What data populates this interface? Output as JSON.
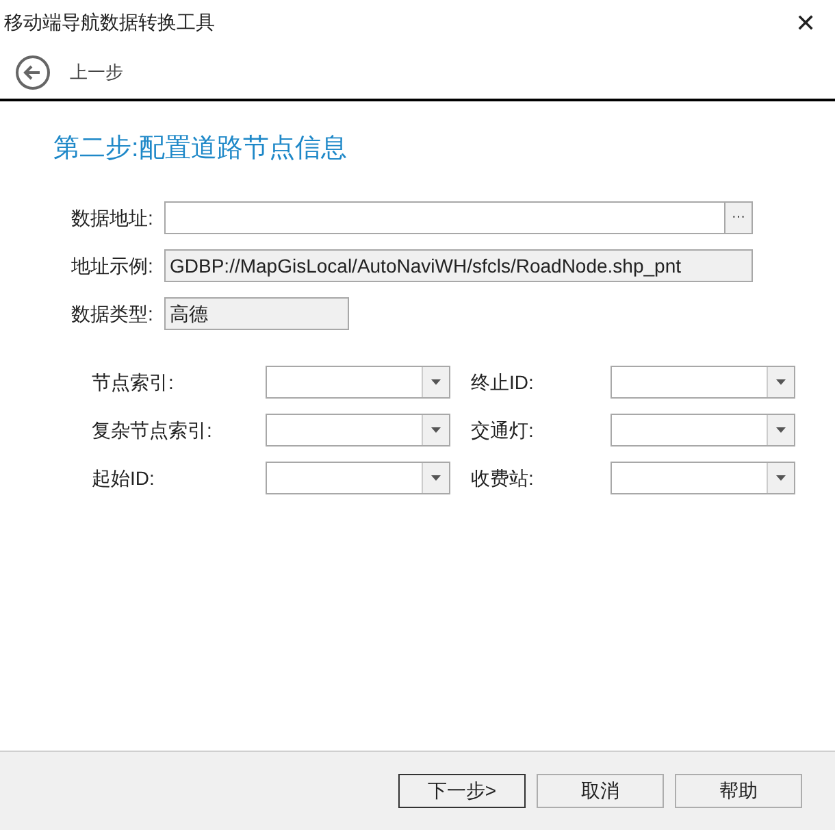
{
  "window": {
    "title": "移动端导航数据转换工具",
    "close": "✕"
  },
  "toolbar": {
    "back_label": "上一步"
  },
  "heading": "第二步:配置道路节点信息",
  "fields": [
    {
      "label": "数据地址:",
      "readonly": false,
      "browse": "···",
      "wide": true
    },
    {
      "label": "地址示例:",
      "value": "GDBP://MapGisLocal/AutoNaviWH/sfcls/RoadNode.shp_pnt",
      "readonly": true,
      "wide": true
    },
    {
      "label": "数据类型:",
      "value": "高德",
      "readonly": true,
      "wide": false
    }
  ],
  "combos": [
    {
      "label": "节点索引:"
    },
    {
      "label": "终止ID:"
    },
    {
      "label": "复杂节点索引:"
    },
    {
      "label": "交通灯:"
    },
    {
      "label": "起始ID:"
    },
    {
      "label": "收费站:"
    }
  ],
  "buttons": [
    {
      "label": "下一步>",
      "default": true
    },
    {
      "label": "取消",
      "default": false
    },
    {
      "label": "帮助",
      "default": false
    }
  ]
}
